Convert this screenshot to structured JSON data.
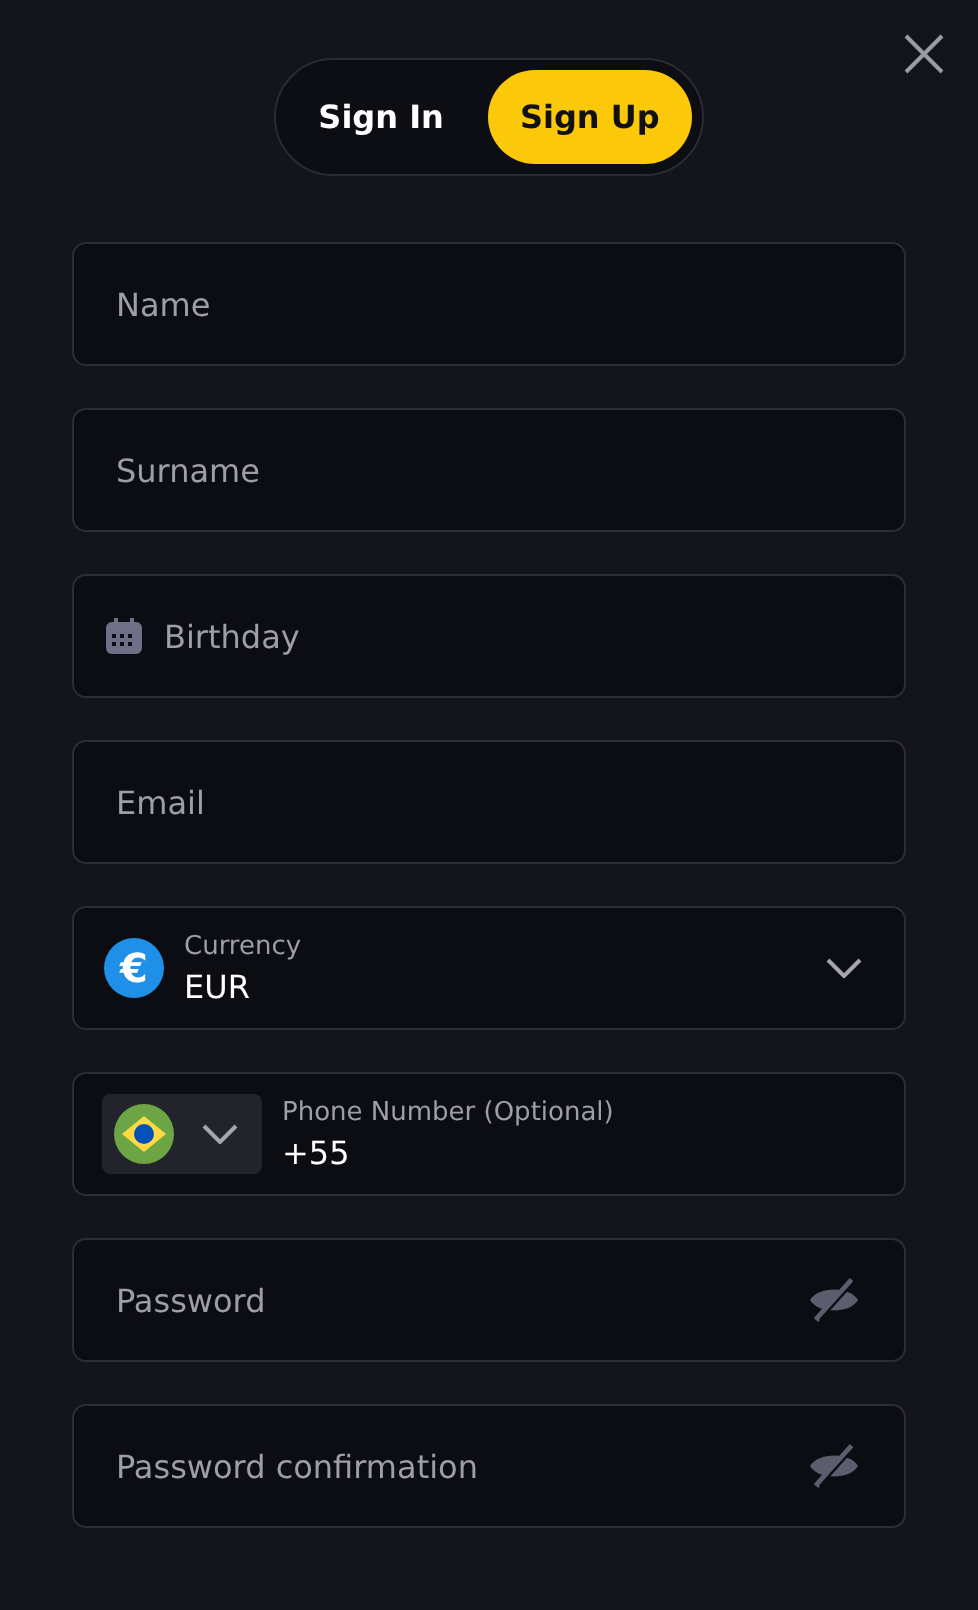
{
  "tabs": [
    {
      "label": "Sign In",
      "selected": false
    },
    {
      "label": "Sign Up",
      "selected": true
    }
  ],
  "fields": [
    {
      "kind": "text",
      "placeholder": "Name"
    },
    {
      "kind": "text",
      "placeholder": "Surname"
    },
    {
      "kind": "date",
      "placeholder": "Birthday"
    },
    {
      "kind": "text",
      "placeholder": "Email"
    },
    {
      "kind": "select",
      "label": "Currency",
      "value": "EUR",
      "icon": "€"
    },
    {
      "kind": "phone",
      "label": "Phone Number (Optional)",
      "value": "+55"
    },
    {
      "kind": "password",
      "placeholder": "Password"
    },
    {
      "kind": "password",
      "placeholder": "Password confirmation"
    }
  ]
}
